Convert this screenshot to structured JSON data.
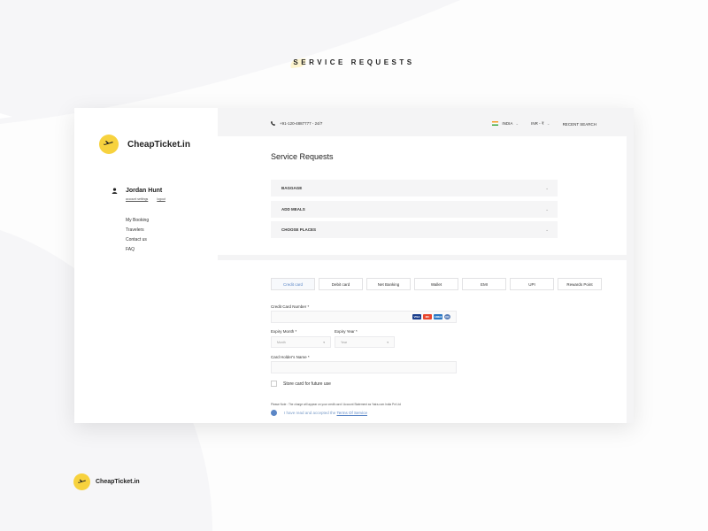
{
  "page": {
    "heading": "SERVICE REQUESTS",
    "heading_highlight": "SE",
    "heading_rest": "RVICE REQUESTS"
  },
  "colors": {
    "brand_yellow": "#f7d23e",
    "accent_blue": "#5b86c6",
    "panel_bg": "#f5f5f6"
  },
  "brand": {
    "name": "CheapTicket.in",
    "icon": "airplane-icon"
  },
  "user": {
    "name": "Jordan Hunt",
    "account_settings": "account settings",
    "logout": "logout",
    "icon": "user-icon"
  },
  "sidebar": {
    "nav": [
      {
        "label": "My Booking"
      },
      {
        "label": "Travelers"
      },
      {
        "label": "Contact us"
      },
      {
        "label": "FAQ"
      }
    ]
  },
  "topbar": {
    "phone": "+91-120-4887777  -  24/7",
    "country": "INDIA",
    "currency": "INR - ₹",
    "recent_search": "RECENT SEARCH"
  },
  "service_requests": {
    "title": "Service Requests",
    "items": [
      {
        "label": "BAGGAGE"
      },
      {
        "label": "ADD MEALS"
      },
      {
        "label": "CHOOSE PLACES"
      }
    ]
  },
  "payment": {
    "tabs": [
      {
        "label": "Credit card",
        "active": true
      },
      {
        "label": "Debit card"
      },
      {
        "label": "Net Banking"
      },
      {
        "label": "Wallet"
      },
      {
        "label": "EMI"
      },
      {
        "label": "UPI"
      },
      {
        "label": "Rewards Point"
      }
    ],
    "card_number_label": "Credit Card Number *",
    "expiry_month_label": "Expiry Month *",
    "expiry_month_placeholder": "Month",
    "expiry_year_label": "Expiry Year *",
    "expiry_year_placeholder": "Year",
    "holder_label": "Card Holder's Name *",
    "store_card": "Store card for future use",
    "note": "Please Note : The charge will appear on your credit card / Account Statement as Yatra.com India Pvt Ltd",
    "terms_prefix": "I have read and accepted the",
    "terms_link": "Terms Of Service",
    "card_brands": [
      "VISA",
      "MC",
      "AMEX",
      "DC"
    ]
  },
  "footer": {
    "brand": "CheapTicket.in"
  }
}
